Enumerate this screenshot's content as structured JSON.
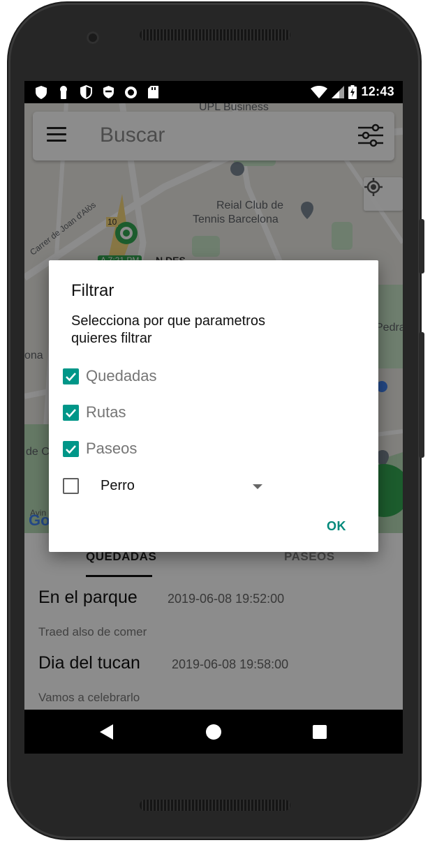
{
  "status_bar": {
    "left_icons": [
      "shield-icon",
      "keyhole-icon",
      "shield-half-icon",
      "shield-check-icon",
      "record-icon",
      "sd-card-icon"
    ],
    "right_icons": [
      "wifi-icon",
      "signal-icon",
      "battery-charging-icon"
    ],
    "time": "12:43"
  },
  "search": {
    "placeholder": "Buscar",
    "menu_icon": "hamburger-menu-icon",
    "filter_icon": "sliders-icon"
  },
  "map": {
    "labels": {
      "upl": "UPL Business",
      "club_line1": "Reial Club de",
      "club_line2": "Tennis Barcelona",
      "street": "Carrer de Joan d'Alòs",
      "route": "10",
      "pedra": "Pedra",
      "ona": "ona",
      "cel": "de Ce",
      "avin": "Avin",
      "google": "Go"
    },
    "chip": "A 7:21 PM",
    "chip_after": "N DES",
    "locate_icon": "my-location-icon"
  },
  "tabs": [
    {
      "label": "QUEDADAS",
      "selected": true
    },
    {
      "label": "PASEOS",
      "selected": false
    }
  ],
  "events": [
    {
      "title": "En el parque",
      "date": "2019-06-08 19:52:00",
      "description": "Traed also de comer"
    },
    {
      "title": "Dia del tucan",
      "date": "2019-06-08 19:58:00",
      "description": "Vamos a celebrarlo"
    }
  ],
  "dialog": {
    "title": "Filtrar",
    "message": "Selecciona por que parametros quieres filtrar",
    "options": [
      {
        "label": "Quedadas",
        "checked": true
      },
      {
        "label": "Rutas",
        "checked": true
      },
      {
        "label": "Paseos",
        "checked": true
      }
    ],
    "extra_option_checked": false,
    "spinner_value": "Perro",
    "ok_label": "OK"
  },
  "colors": {
    "accent": "#009688",
    "ok_text": "#00897b",
    "map_green": "#c8e6c9"
  }
}
